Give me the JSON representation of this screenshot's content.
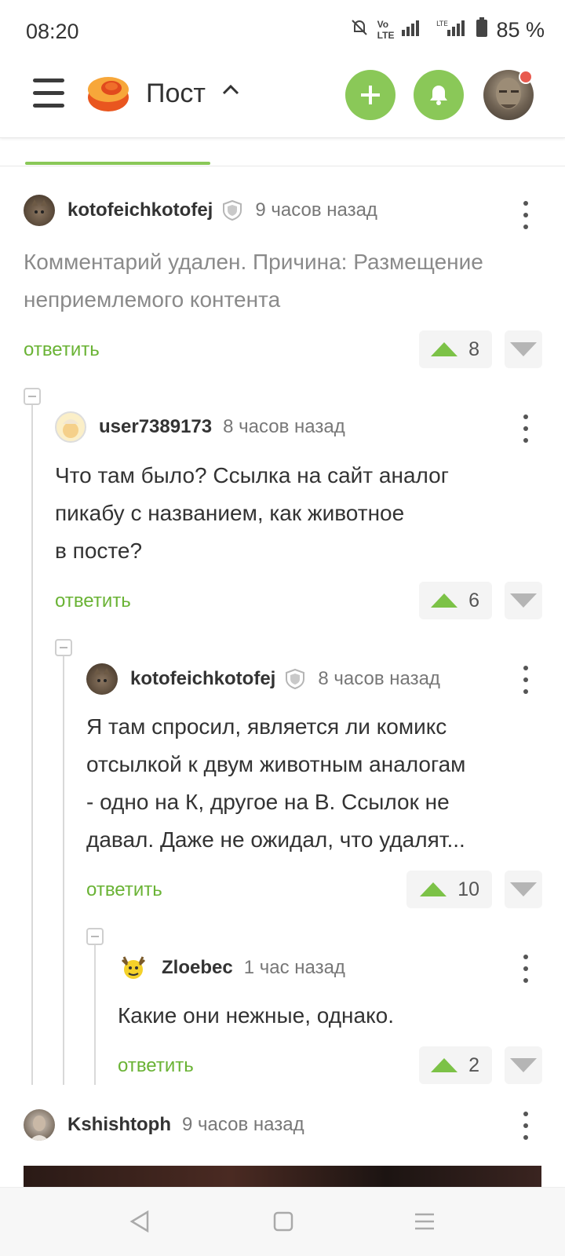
{
  "status": {
    "time": "08:20",
    "battery": "85 %"
  },
  "header": {
    "title": "Пост",
    "caret": "^"
  },
  "comments": [
    {
      "user": "kotofeichkotofej",
      "time": "9 часов назад",
      "text": "Комментарий удален. Причина: Размещение неприемлемого контента",
      "reply": "ответить",
      "votes": "8"
    },
    {
      "user": "user7389173",
      "time": "8 часов назад",
      "text_lines": [
        "Что там было? Ссылка на сайт аналог",
        "пикабу с названием, как животное",
        "в посте?"
      ],
      "reply": "ответить",
      "votes": "6"
    },
    {
      "user": "kotofeichkotofej",
      "time": "8 часов назад",
      "text_lines": [
        "Я там спросил, является ли комикс",
        "отсылкой к двум животным аналогам",
        "- одно на К, другое на В. Ссылок не",
        "давал. Даже не ожидал, что удалят..."
      ],
      "reply": "ответить",
      "votes": "10"
    },
    {
      "user": "Zloebec",
      "time": "1 час назад",
      "text": "Какие они нежные, однако.",
      "reply": "ответить",
      "votes": "2"
    },
    {
      "user": "Kshishtoph",
      "time": "9 часов назад"
    }
  ],
  "colors": {
    "accent": "#8ac858",
    "link": "#6ab335",
    "upvote": "#7cc247",
    "notification": "#e85a4f"
  }
}
